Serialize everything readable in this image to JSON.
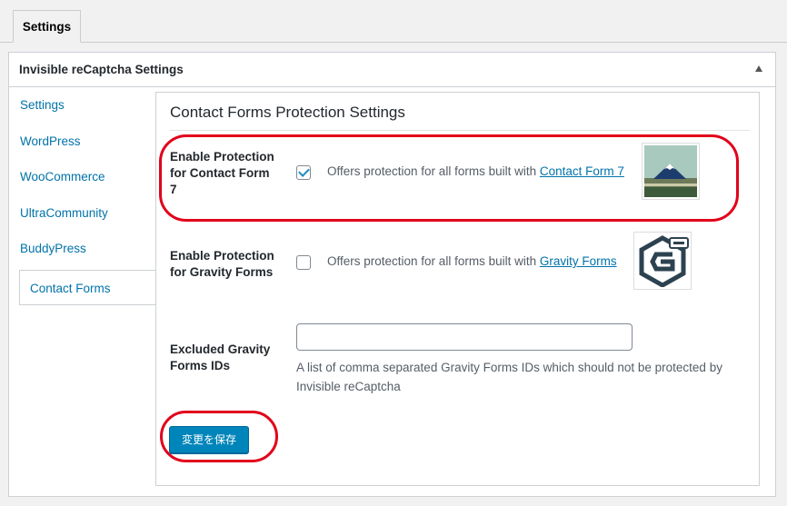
{
  "tabs": [
    {
      "label": "Settings"
    }
  ],
  "postbox": {
    "title": "Invisible reCaptcha Settings"
  },
  "sidebar": {
    "items": [
      {
        "label": "Settings"
      },
      {
        "label": "WordPress"
      },
      {
        "label": "WooCommerce"
      },
      {
        "label": "UltraCommunity"
      },
      {
        "label": "BuddyPress"
      },
      {
        "label": "Contact Forms",
        "active": true
      }
    ]
  },
  "main": {
    "section_title": "Contact Forms Protection Settings",
    "cf7": {
      "label": "Enable Protection for Contact Form 7",
      "checked": true,
      "desc_prefix": "Offers protection for all forms built with ",
      "link_text": "Contact Form 7"
    },
    "gravity": {
      "label": "Enable Protection for Gravity Forms",
      "checked": false,
      "desc_prefix": "Offers protection for all forms built with ",
      "link_text": "Gravity Forms"
    },
    "excluded": {
      "label": "Excluded Gravity Forms IDs",
      "value": "",
      "placeholder": "",
      "help": "A list of comma separated Gravity Forms IDs which should not be protected by Invisible reCaptcha"
    },
    "save_label": "変更を保存"
  },
  "colors": {
    "accent": "#0085ba",
    "link": "#0073aa",
    "annotation": "#e2001a"
  },
  "icons": [
    "toggle-arrow-up-icon",
    "checkmark-icon",
    "contact-form-7-logo",
    "gravity-forms-logo"
  ]
}
